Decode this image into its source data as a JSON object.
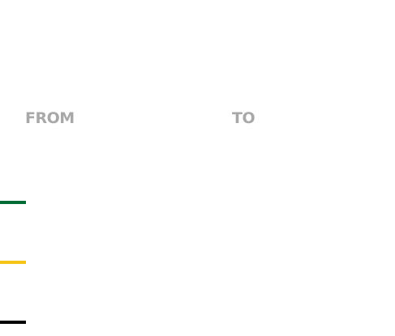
{
  "route": {
    "from_label": "FROM",
    "to_label": "TO"
  },
  "legend": {
    "swatches": [
      {
        "color": "#006b35"
      },
      {
        "color": "#f5c518"
      },
      {
        "color": "#000000"
      }
    ]
  },
  "colors": {
    "label_text": "#a8a8a8",
    "background": "#ffffff"
  }
}
